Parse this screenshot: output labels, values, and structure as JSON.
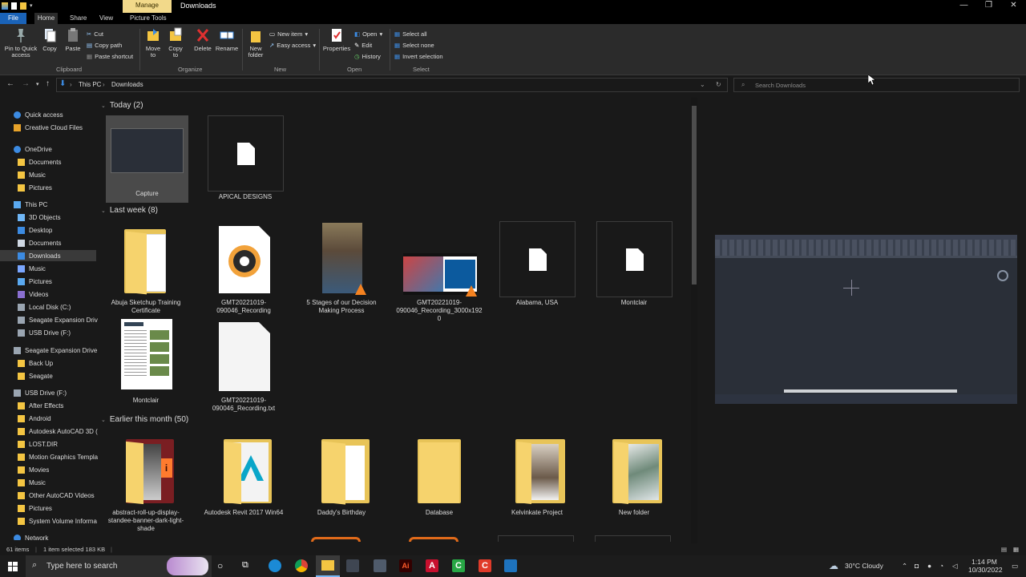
{
  "window": {
    "title": "Downloads",
    "contextual_tab": "Manage",
    "tabs": [
      "File",
      "Home",
      "Share",
      "View",
      "Picture Tools"
    ]
  },
  "ribbon": {
    "clipboard": {
      "pin": "Pin to Quick access",
      "copy": "Copy",
      "paste": "Paste",
      "cut": "Cut",
      "copy_path": "Copy path",
      "paste_shortcut": "Paste shortcut",
      "label": "Clipboard"
    },
    "organize": {
      "move_to": "Move to",
      "copy_to": "Copy to",
      "delete": "Delete",
      "rename": "Rename",
      "label": "Organize"
    },
    "new": {
      "new_folder": "New folder",
      "new_item": "New item",
      "easy_access": "Easy access",
      "label": "New"
    },
    "open": {
      "properties": "Properties",
      "open": "Open",
      "edit": "Edit",
      "history": "History",
      "label": "Open"
    },
    "select": {
      "select_all": "Select all",
      "select_none": "Select none",
      "invert": "Invert selection",
      "label": "Select"
    }
  },
  "address": {
    "crumbs": [
      "This PC",
      "Downloads"
    ],
    "search_placeholder": "Search Downloads"
  },
  "nav": [
    {
      "label": "Quick access",
      "type": "star",
      "indent": 0
    },
    {
      "label": "Creative Cloud Files",
      "type": "cc",
      "indent": 0
    },
    {
      "label": "OneDrive",
      "type": "cloud",
      "indent": 0
    },
    {
      "label": "Documents",
      "type": "folder",
      "indent": 1
    },
    {
      "label": "Music",
      "type": "folder",
      "indent": 1
    },
    {
      "label": "Pictures",
      "type": "folder",
      "indent": 1
    },
    {
      "label": "This PC",
      "type": "pc",
      "indent": 0
    },
    {
      "label": "3D Objects",
      "type": "obj3d",
      "indent": 1
    },
    {
      "label": "Desktop",
      "type": "desktop",
      "indent": 1
    },
    {
      "label": "Documents",
      "type": "docs",
      "indent": 1
    },
    {
      "label": "Downloads",
      "type": "download",
      "indent": 1,
      "selected": true
    },
    {
      "label": "Music",
      "type": "music",
      "indent": 1
    },
    {
      "label": "Pictures",
      "type": "pics",
      "indent": 1
    },
    {
      "label": "Videos",
      "type": "videos",
      "indent": 1
    },
    {
      "label": "Local Disk (C:)",
      "type": "disk",
      "indent": 1
    },
    {
      "label": "Seagate Expansion Drive",
      "type": "disk",
      "indent": 1
    },
    {
      "label": "USB Drive (F:)",
      "type": "disk",
      "indent": 1
    },
    {
      "label": "Seagate Expansion Drive (",
      "type": "disk",
      "indent": 0
    },
    {
      "label": "Back Up",
      "type": "folder",
      "indent": 1
    },
    {
      "label": "Seagate",
      "type": "folder",
      "indent": 1
    },
    {
      "label": "USB Drive (F:)",
      "type": "disk",
      "indent": 0
    },
    {
      "label": "After Effects",
      "type": "folder",
      "indent": 1
    },
    {
      "label": "Android",
      "type": "folder",
      "indent": 1
    },
    {
      "label": "Autodesk AutoCAD 3D (",
      "type": "folder",
      "indent": 1
    },
    {
      "label": "LOST.DIR",
      "type": "folder",
      "indent": 1
    },
    {
      "label": "Motion Graphics Templa",
      "type": "folder",
      "indent": 1
    },
    {
      "label": "Movies",
      "type": "folder",
      "indent": 1
    },
    {
      "label": "Music",
      "type": "folder",
      "indent": 1
    },
    {
      "label": "Other AutoCAD Videos",
      "type": "folder",
      "indent": 1
    },
    {
      "label": "Pictures",
      "type": "folder",
      "indent": 1
    },
    {
      "label": "System Volume Informa",
      "type": "folder",
      "indent": 1
    },
    {
      "label": "Network",
      "type": "network",
      "indent": 0
    }
  ],
  "groups": [
    {
      "header": "Today (2)"
    },
    {
      "header": "Last week (8)"
    },
    {
      "header": "Earlier this month (50)"
    }
  ],
  "items": {
    "today": [
      {
        "label": "Capture",
        "kind": "image-selected"
      },
      {
        "label": "APICAL DESIGNS",
        "kind": "blank"
      }
    ],
    "lastweek": [
      {
        "label": "Abuja Sketchup Training Certificate",
        "kind": "folder"
      },
      {
        "label": "GMT20221019-090046_Recording",
        "kind": "audio"
      },
      {
        "label": "5 Stages of our Decision Making Process",
        "kind": "photo"
      },
      {
        "label": "GMT20221019-090046_Recording_3000x1920",
        "kind": "video"
      },
      {
        "label": "Alabama, USA",
        "kind": "blank"
      },
      {
        "label": "Montclair",
        "kind": "blank"
      },
      {
        "label": "Montclair",
        "kind": "doc"
      },
      {
        "label": "GMT20221019-090046_Recording.txt",
        "kind": "txt"
      }
    ],
    "earlier": [
      {
        "label": "abstract-roll-up-display-standee-banner-dark-light-shade",
        "kind": "folder-ai"
      },
      {
        "label": "Autodesk Revit 2017 Win64",
        "kind": "folder-revit"
      },
      {
        "label": "Daddy's Birthday",
        "kind": "folder-plain"
      },
      {
        "label": "Database",
        "kind": "folder-plain"
      },
      {
        "label": "Kelvinkate Project",
        "kind": "folder-photo"
      },
      {
        "label": "New folder",
        "kind": "folder-photo2"
      }
    ]
  },
  "status": {
    "count": "61 items",
    "selection": "1 item selected  183 KB"
  },
  "taskbar": {
    "search": "Type here to search",
    "weather": "30°C  Cloudy",
    "time": "1:14 PM",
    "date": "10/30/2022"
  }
}
